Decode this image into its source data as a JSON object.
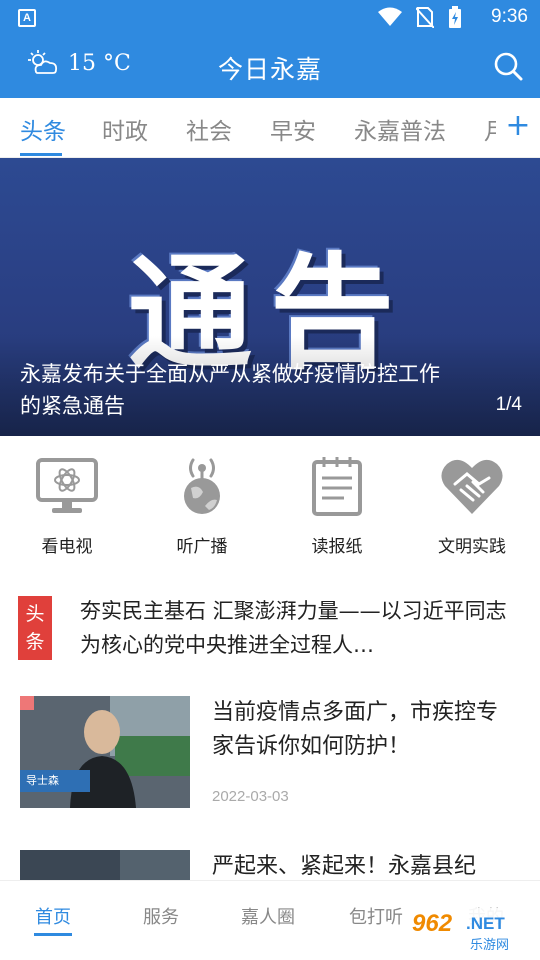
{
  "status_bar": {
    "time": "9:36",
    "notification_letter": "A"
  },
  "app_bar": {
    "weather_temp": "15 °C",
    "weather_icon": "partly-cloudy-icon",
    "title": "今日永嘉",
    "search_icon": "search-icon"
  },
  "tabs": [
    {
      "label": "头条",
      "active": true
    },
    {
      "label": "时政"
    },
    {
      "label": "社会"
    },
    {
      "label": "早安"
    },
    {
      "label": "永嘉普法"
    },
    {
      "label": "月"
    }
  ],
  "tab_add_label": "+",
  "banner": {
    "big_text": "通告",
    "caption": "永嘉发布关于全面从严从紧做好疫情防控工作的紧急通告",
    "pager": "1/4"
  },
  "quick_links": [
    {
      "label": "看电视",
      "icon": "tv-icon"
    },
    {
      "label": "听广播",
      "icon": "radio-globe-icon"
    },
    {
      "label": "读报纸",
      "icon": "newspaper-icon"
    },
    {
      "label": "文明实践",
      "icon": "heart-handshake-icon"
    }
  ],
  "headline": {
    "badge": "头条",
    "text": "夯实民主基石 汇聚澎湃力量——以习近平同志为核心的党中央推进全过程人…"
  },
  "news": [
    {
      "title": "当前疫情点多面广，市疾控专家告诉你如何防护！",
      "date": "2022-03-03",
      "thumb_caption": "导士森"
    },
    {
      "title": "严起来、紧起来！永嘉县纪",
      "date": ""
    }
  ],
  "bottom_nav": [
    {
      "label": "首页",
      "active": true
    },
    {
      "label": "服务"
    },
    {
      "label": "嘉人圈"
    },
    {
      "label": "包打听"
    },
    {
      "label": "我的"
    }
  ],
  "watermark": {
    "num": "962",
    "net": ".NET",
    "sub": "乐游网"
  },
  "colors": {
    "primary": "#2f8ae0",
    "badge_red": "#e0403b",
    "banner_blue": "#2d4a92"
  }
}
